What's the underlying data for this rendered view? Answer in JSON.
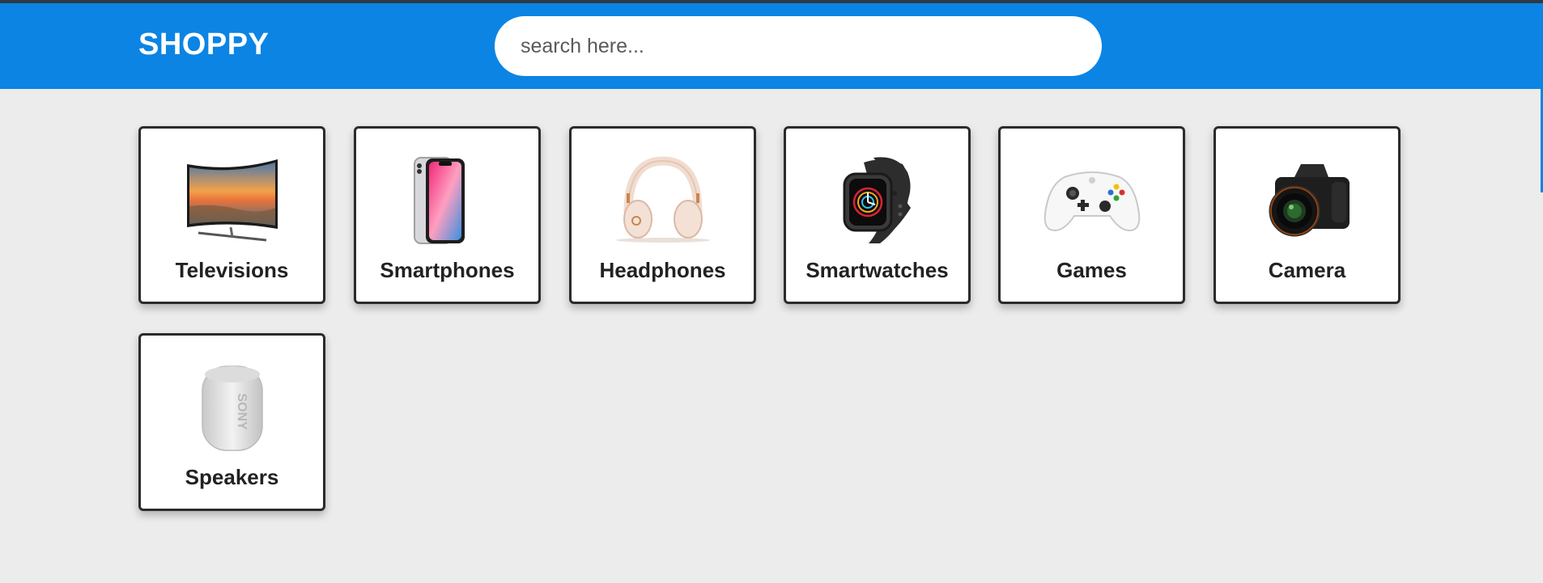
{
  "brand": {
    "name": "SHOPPY",
    "color": "#0b84e4"
  },
  "search": {
    "placeholder": "search here...",
    "value": ""
  },
  "categories": [
    {
      "label": "Televisions",
      "icon": "television-icon"
    },
    {
      "label": "Smartphones",
      "icon": "smartphone-icon"
    },
    {
      "label": "Headphones",
      "icon": "headphones-icon"
    },
    {
      "label": "Smartwatches",
      "icon": "smartwatch-icon"
    },
    {
      "label": "Games",
      "icon": "game-controller-icon"
    },
    {
      "label": "Camera",
      "icon": "camera-icon"
    },
    {
      "label": "Speakers",
      "icon": "speaker-icon"
    }
  ]
}
